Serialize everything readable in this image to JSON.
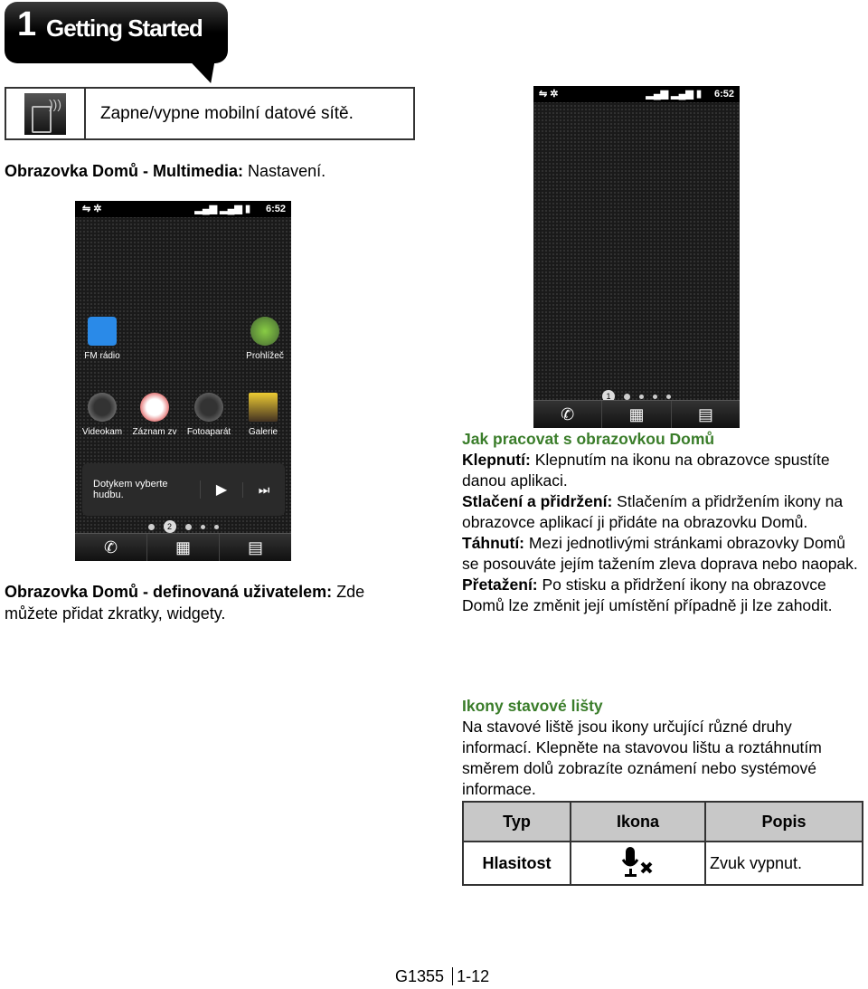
{
  "header": {
    "chapter": "1",
    "title": "Getting Started"
  },
  "icon_table": {
    "icon": "mobile-data-icon",
    "text": "Zapne/vypne mobilní datové sítě."
  },
  "left": {
    "multimedia_label": "Obrazovka Domů - Multimedia:",
    "multimedia_text": " Nastavení.",
    "custom_label": "Obrazovka Domů - definovaná uživatelem:",
    "custom_text": " Zde můžete přidat zkratky, widgety."
  },
  "phone1": {
    "time": "6:52",
    "apps": [
      "FM rádio",
      "Prohlížeč",
      "Videokam",
      "Záznam zv",
      "Fotoaparát",
      "Galerie"
    ],
    "music_widget": "Dotykem vyberte hudbu.",
    "page": "2"
  },
  "phone2": {
    "time": "6:52",
    "page": "1"
  },
  "right": {
    "heading1": "Jak pracovat s obrazovkou Domů",
    "items": [
      {
        "term": "Klepnutí:",
        "text": " Klepnutím na ikonu na obrazovce spustíte danou aplikaci."
      },
      {
        "term": "Stlačení a přidržení:",
        "text": " Stlačením a přidržením ikony na obrazovce aplikací ji přidáte na obrazovku Domů."
      },
      {
        "term": "Táhnutí:",
        "text": " Mezi jednotlivými stránkami obrazovky Domů se posouváte jejím tažením zleva doprava nebo naopak."
      },
      {
        "term": "Přetažení:",
        "text": " Po stisku a přidržení ikony na obrazovce Domů lze změnit její umístění případně ji lze zahodit."
      }
    ],
    "heading2": "Ikony stavové lišty",
    "para2": "Na stavové liště jsou ikony určující různé druhy informací. Klepněte na stavovou lištu a roztáhnutím směrem dolů zobrazíte oznámení nebo systémové informace."
  },
  "status_table": {
    "headers": [
      "Typ",
      "Ikona",
      "Popis"
    ],
    "rows": [
      {
        "type": "Hlasitost",
        "icon": "mic-muted-icon",
        "desc": "Zvuk vypnut."
      }
    ]
  },
  "footer": {
    "model": "G1355",
    "page": "1-12"
  },
  "colors": {
    "heading_green": "#3a7d2a",
    "table_header": "#c8c8c8"
  }
}
